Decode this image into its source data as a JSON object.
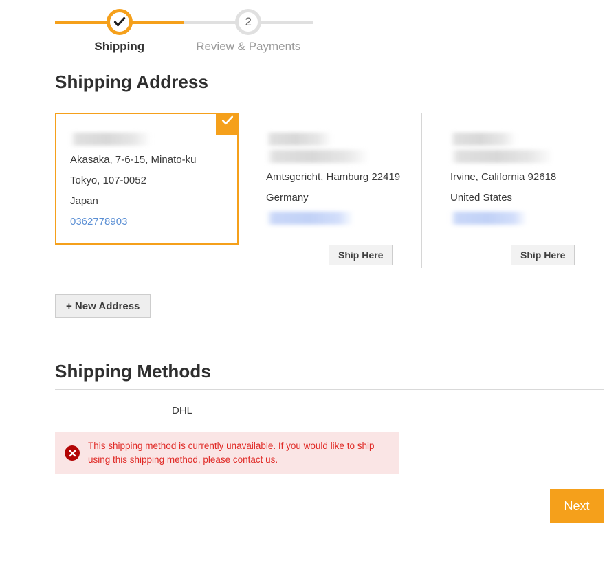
{
  "theme": {
    "accent": "#f5a01b",
    "link": "#5b8fd4",
    "error_text": "#e02b27",
    "error_bg": "#fae5e5",
    "error_icon_bg": "#b30505",
    "rail_inactive": "#e0e0e0"
  },
  "progress": {
    "steps": [
      {
        "label": "Shipping",
        "state": "done",
        "badge": "check-icon"
      },
      {
        "label": "Review & Payments",
        "state": "todo",
        "badge": "2"
      }
    ]
  },
  "shipping_address": {
    "title": "Shipping Address",
    "cards": [
      {
        "selected": true,
        "selected_badge": "check-icon",
        "redacted_lines": [
          1
        ],
        "lines": [
          "Akasaka, 7-6-15, Minato-ku",
          "Tokyo, 107-0052",
          "Japan"
        ],
        "phone": "0362778903",
        "phone_redacted": false,
        "ship_here_label": null
      },
      {
        "selected": false,
        "redacted_lines": [
          2
        ],
        "lines": [
          "Amtsgericht, Hamburg 22419",
          "Germany"
        ],
        "phone": null,
        "phone_redacted": true,
        "ship_here_label": "Ship Here"
      },
      {
        "selected": false,
        "redacted_lines": [
          2
        ],
        "lines": [
          "Irvine, California 92618",
          "United States"
        ],
        "phone": null,
        "phone_redacted": true,
        "ship_here_label": "Ship Here"
      }
    ],
    "new_address_label": "+ New Address"
  },
  "shipping_methods": {
    "title": "Shipping Methods",
    "carrier": "DHL",
    "error": {
      "icon": "error-x-icon",
      "message": "This shipping method is currently unavailable. If you would like to ship using this shipping method, please contact us."
    }
  },
  "footer": {
    "next_label": "Next"
  }
}
